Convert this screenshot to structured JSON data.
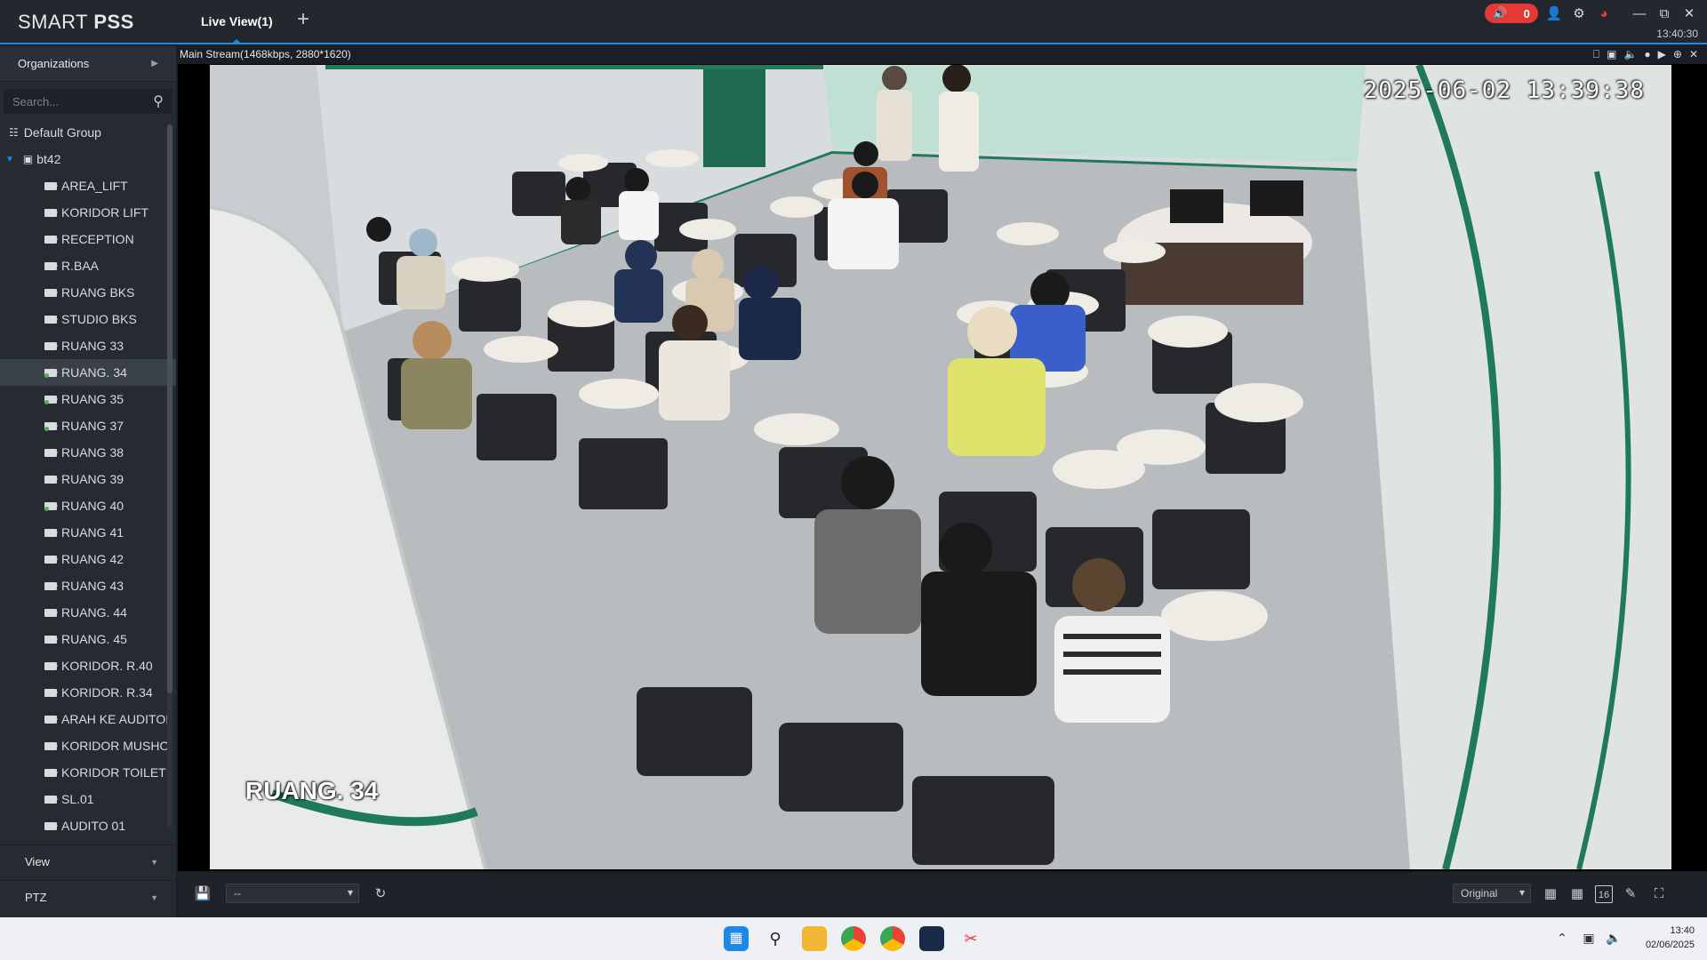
{
  "app": {
    "logo_plain": "SMART ",
    "logo_bold": "PSS",
    "tab_label": "Live View(1)",
    "add_tab_glyph": "+",
    "alarm_count": "0",
    "clock": "13:40:30"
  },
  "sidebar": {
    "organizations_label": "Organizations",
    "search_placeholder": "Search...",
    "group_label": "Default Group",
    "device_label": "bt42",
    "channels": [
      {
        "label": "AREA_LIFT",
        "online": false
      },
      {
        "label": "KORIDOR LIFT",
        "online": false
      },
      {
        "label": "RECEPTION",
        "online": false
      },
      {
        "label": "R.BAA",
        "online": false
      },
      {
        "label": "RUANG BKS",
        "online": false
      },
      {
        "label": "STUDIO BKS",
        "online": false
      },
      {
        "label": "RUANG 33",
        "online": false
      },
      {
        "label": "RUANG. 34",
        "online": true,
        "selected": true
      },
      {
        "label": "RUANG 35",
        "online": true
      },
      {
        "label": "RUANG  37",
        "online": true
      },
      {
        "label": "RUANG 38",
        "online": false
      },
      {
        "label": "RUANG 39",
        "online": false
      },
      {
        "label": "RUANG 40",
        "online": true
      },
      {
        "label": "RUANG 41",
        "online": false
      },
      {
        "label": "RUANG 42",
        "online": false
      },
      {
        "label": "RUANG 43",
        "online": false
      },
      {
        "label": "RUANG. 44",
        "online": false
      },
      {
        "label": "RUANG. 45",
        "online": false
      },
      {
        "label": "KORIDOR. R.40",
        "online": false
      },
      {
        "label": "KORIDOR. R.34",
        "online": false
      },
      {
        "label": "ARAH KE AUDITOI",
        "online": false
      },
      {
        "label": "KORIDOR MUSHO",
        "online": false
      },
      {
        "label": "KORIDOR TOILET",
        "online": false
      },
      {
        "label": "SL.01",
        "online": false
      },
      {
        "label": "AUDITO 01",
        "online": false
      }
    ],
    "view_label": "View",
    "ptz_label": "PTZ"
  },
  "video": {
    "stream_info": "Main Stream(1468kbps, 2880*1620)",
    "osd_timestamp": "2025-06-02 13:39:38",
    "osd_channel": "RUANG. 34"
  },
  "controls": {
    "preset_value": "--",
    "ratio_value": "Original",
    "layout_16_label": "16"
  },
  "taskbar": {
    "time": "13:40",
    "date": "02/06/2025"
  },
  "colors": {
    "accent": "#1e88e5",
    "alarm": "#e53935",
    "online": "#4caf50",
    "wall_green": "#1f7a5a"
  }
}
